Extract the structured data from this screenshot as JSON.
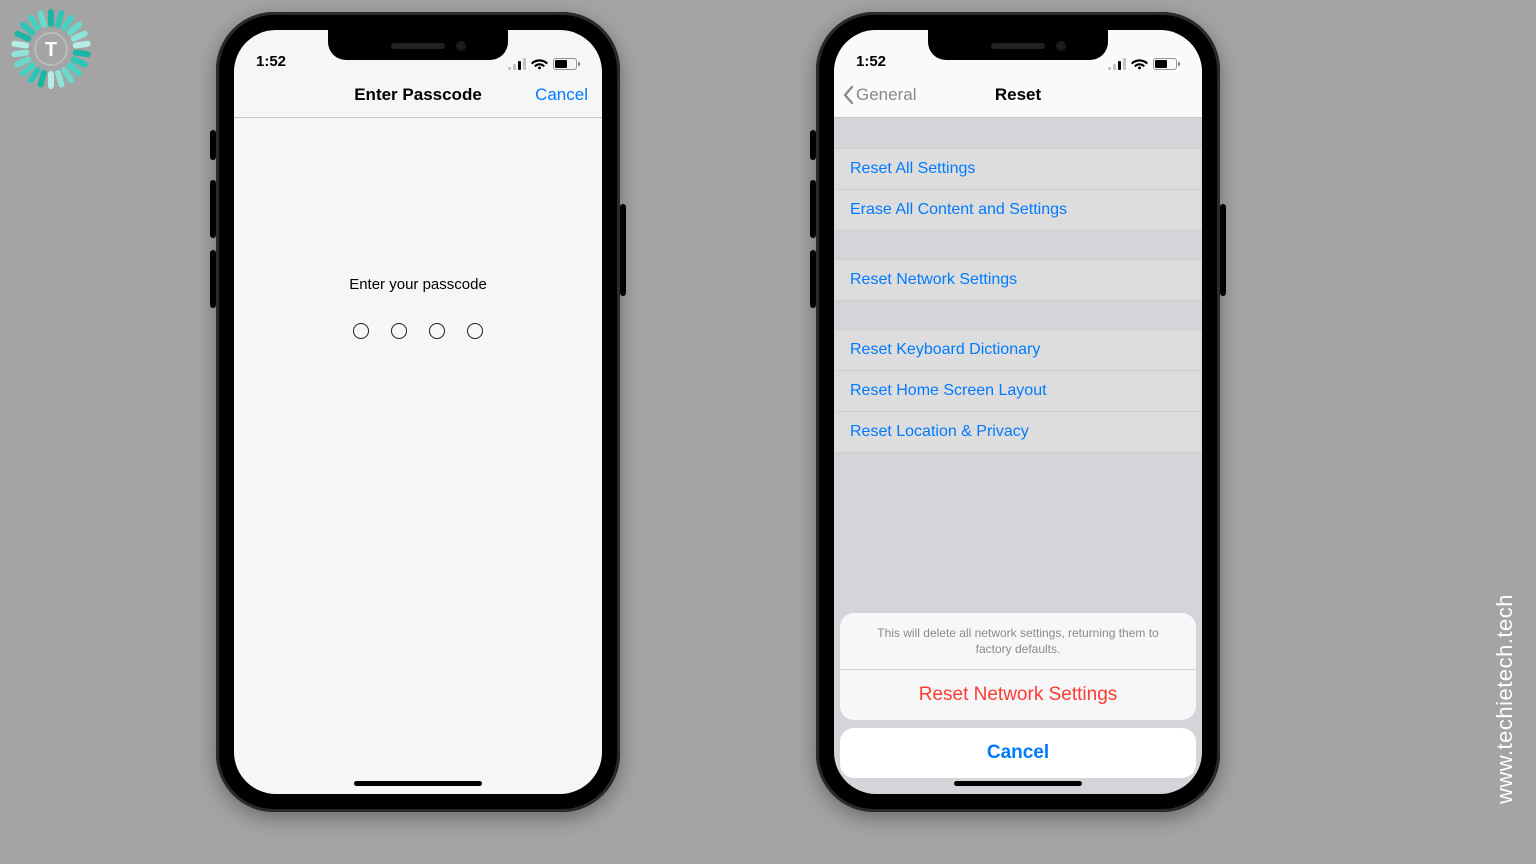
{
  "site": {
    "url": "www.techietech.tech",
    "logo_letter": "T"
  },
  "colors": {
    "link": "#007aff",
    "destructive": "#ff3b30"
  },
  "statusbar": {
    "time": "1:52"
  },
  "phone_left": {
    "nav": {
      "title": "Enter Passcode",
      "right": "Cancel"
    },
    "prompt": "Enter your passcode",
    "passcode_length": 4
  },
  "phone_right": {
    "nav": {
      "title": "Reset",
      "back": "General"
    },
    "groups": [
      {
        "items": [
          "Reset All Settings",
          "Erase All Content and Settings"
        ]
      },
      {
        "items": [
          "Reset Network Settings"
        ]
      },
      {
        "items": [
          "Reset Keyboard Dictionary",
          "Reset Home Screen Layout",
          "Reset Location & Privacy"
        ]
      }
    ],
    "sheet": {
      "message": "This will delete all network settings, returning them to factory defaults.",
      "action": "Reset Network Settings",
      "cancel": "Cancel"
    }
  }
}
